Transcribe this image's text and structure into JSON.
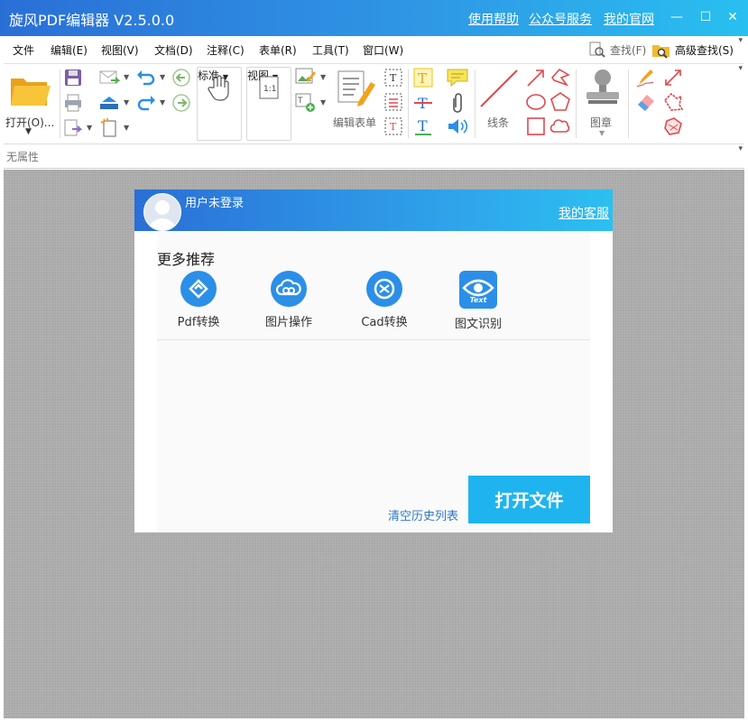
{
  "window": {
    "title": "旋风PDF编辑器 V2.5.0.0",
    "links": [
      "使用帮助",
      "公众号服务",
      "我的官网"
    ],
    "controls": [
      "—",
      "☐",
      "✕"
    ]
  },
  "menu": {
    "items": [
      "文件",
      "编辑(E)",
      "视图(V)",
      "文档(D)",
      "注释(C)",
      "表单(R)",
      "工具(T)",
      "窗口(W)"
    ],
    "find": "查找(F)",
    "advanced_find": "高级查找(S)"
  },
  "toolbar": {
    "open": "打开(O)...",
    "standard": "标准",
    "view": "视图",
    "edit_form": "编辑表单",
    "lines": "线条",
    "stamp": "图章"
  },
  "properties": {
    "label": "无属性"
  },
  "panel": {
    "user": "用户未登录",
    "service": "我的客服",
    "more_title": "更多推荐",
    "recommendations": [
      {
        "label": "Pdf转换",
        "icon": "pdf-convert-icon"
      },
      {
        "label": "图片操作",
        "icon": "image-operation-icon"
      },
      {
        "label": "Cad转换",
        "icon": "cad-convert-icon"
      },
      {
        "label": "图文识别",
        "icon": "ocr-eye-icon",
        "badge": "Text"
      }
    ],
    "clear_history": "清空历史列表",
    "open_file": "打开文件"
  },
  "colors": {
    "title_bar": "#2a6fd6",
    "accent": "#1fb4f0",
    "icon_blue": "#2b8fe8",
    "annotation_red": "#e0484f"
  }
}
